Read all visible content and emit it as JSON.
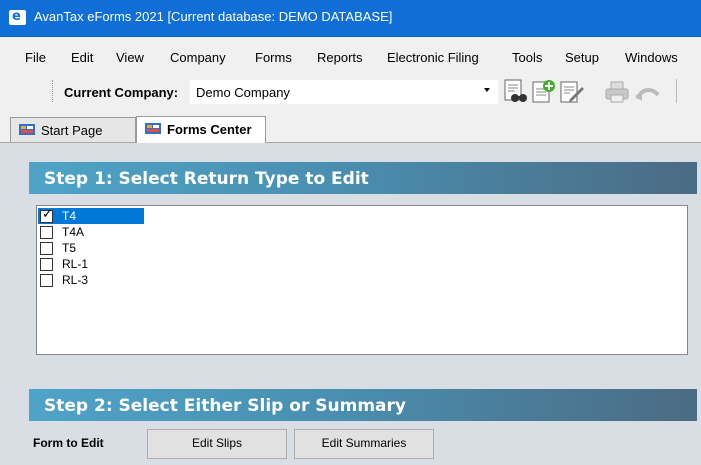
{
  "window": {
    "title": "AvanTax eForms 2021 [Current database: DEMO DATABASE]",
    "app_icon_letter": "e"
  },
  "menu": {
    "items": [
      "File",
      "Edit",
      "View",
      "Company",
      "Forms",
      "Reports",
      "Electronic Filing",
      "Tools",
      "Setup",
      "Windows"
    ]
  },
  "toolbar": {
    "company_label": "Current Company:",
    "company_value": "Demo Company",
    "icons": [
      "find-icon",
      "new-form-icon",
      "edit-form-icon",
      "print-icon",
      "undo-icon"
    ]
  },
  "tabs": [
    {
      "label": "Start Page",
      "active": false
    },
    {
      "label": "Forms Center",
      "active": true
    }
  ],
  "step1": {
    "title": "Step 1: Select Return Type to Edit",
    "return_types": [
      {
        "label": "T4",
        "checked": true,
        "selected": true
      },
      {
        "label": "T4A",
        "checked": false,
        "selected": false
      },
      {
        "label": "T5",
        "checked": false,
        "selected": false
      },
      {
        "label": "RL-1",
        "checked": false,
        "selected": false
      },
      {
        "label": "RL-3",
        "checked": false,
        "selected": false
      }
    ]
  },
  "step2": {
    "title": "Step 2: Select Either Slip or Summary",
    "form_label": "Form to Edit",
    "edit_slips_label": "Edit Slips",
    "edit_summaries_label": "Edit Summaries"
  },
  "colors": {
    "titlebar": "#0f6fd6",
    "selection": "#0078d7",
    "step_header_start": "#4ea4c7",
    "step_header_end": "#4b6b83"
  }
}
